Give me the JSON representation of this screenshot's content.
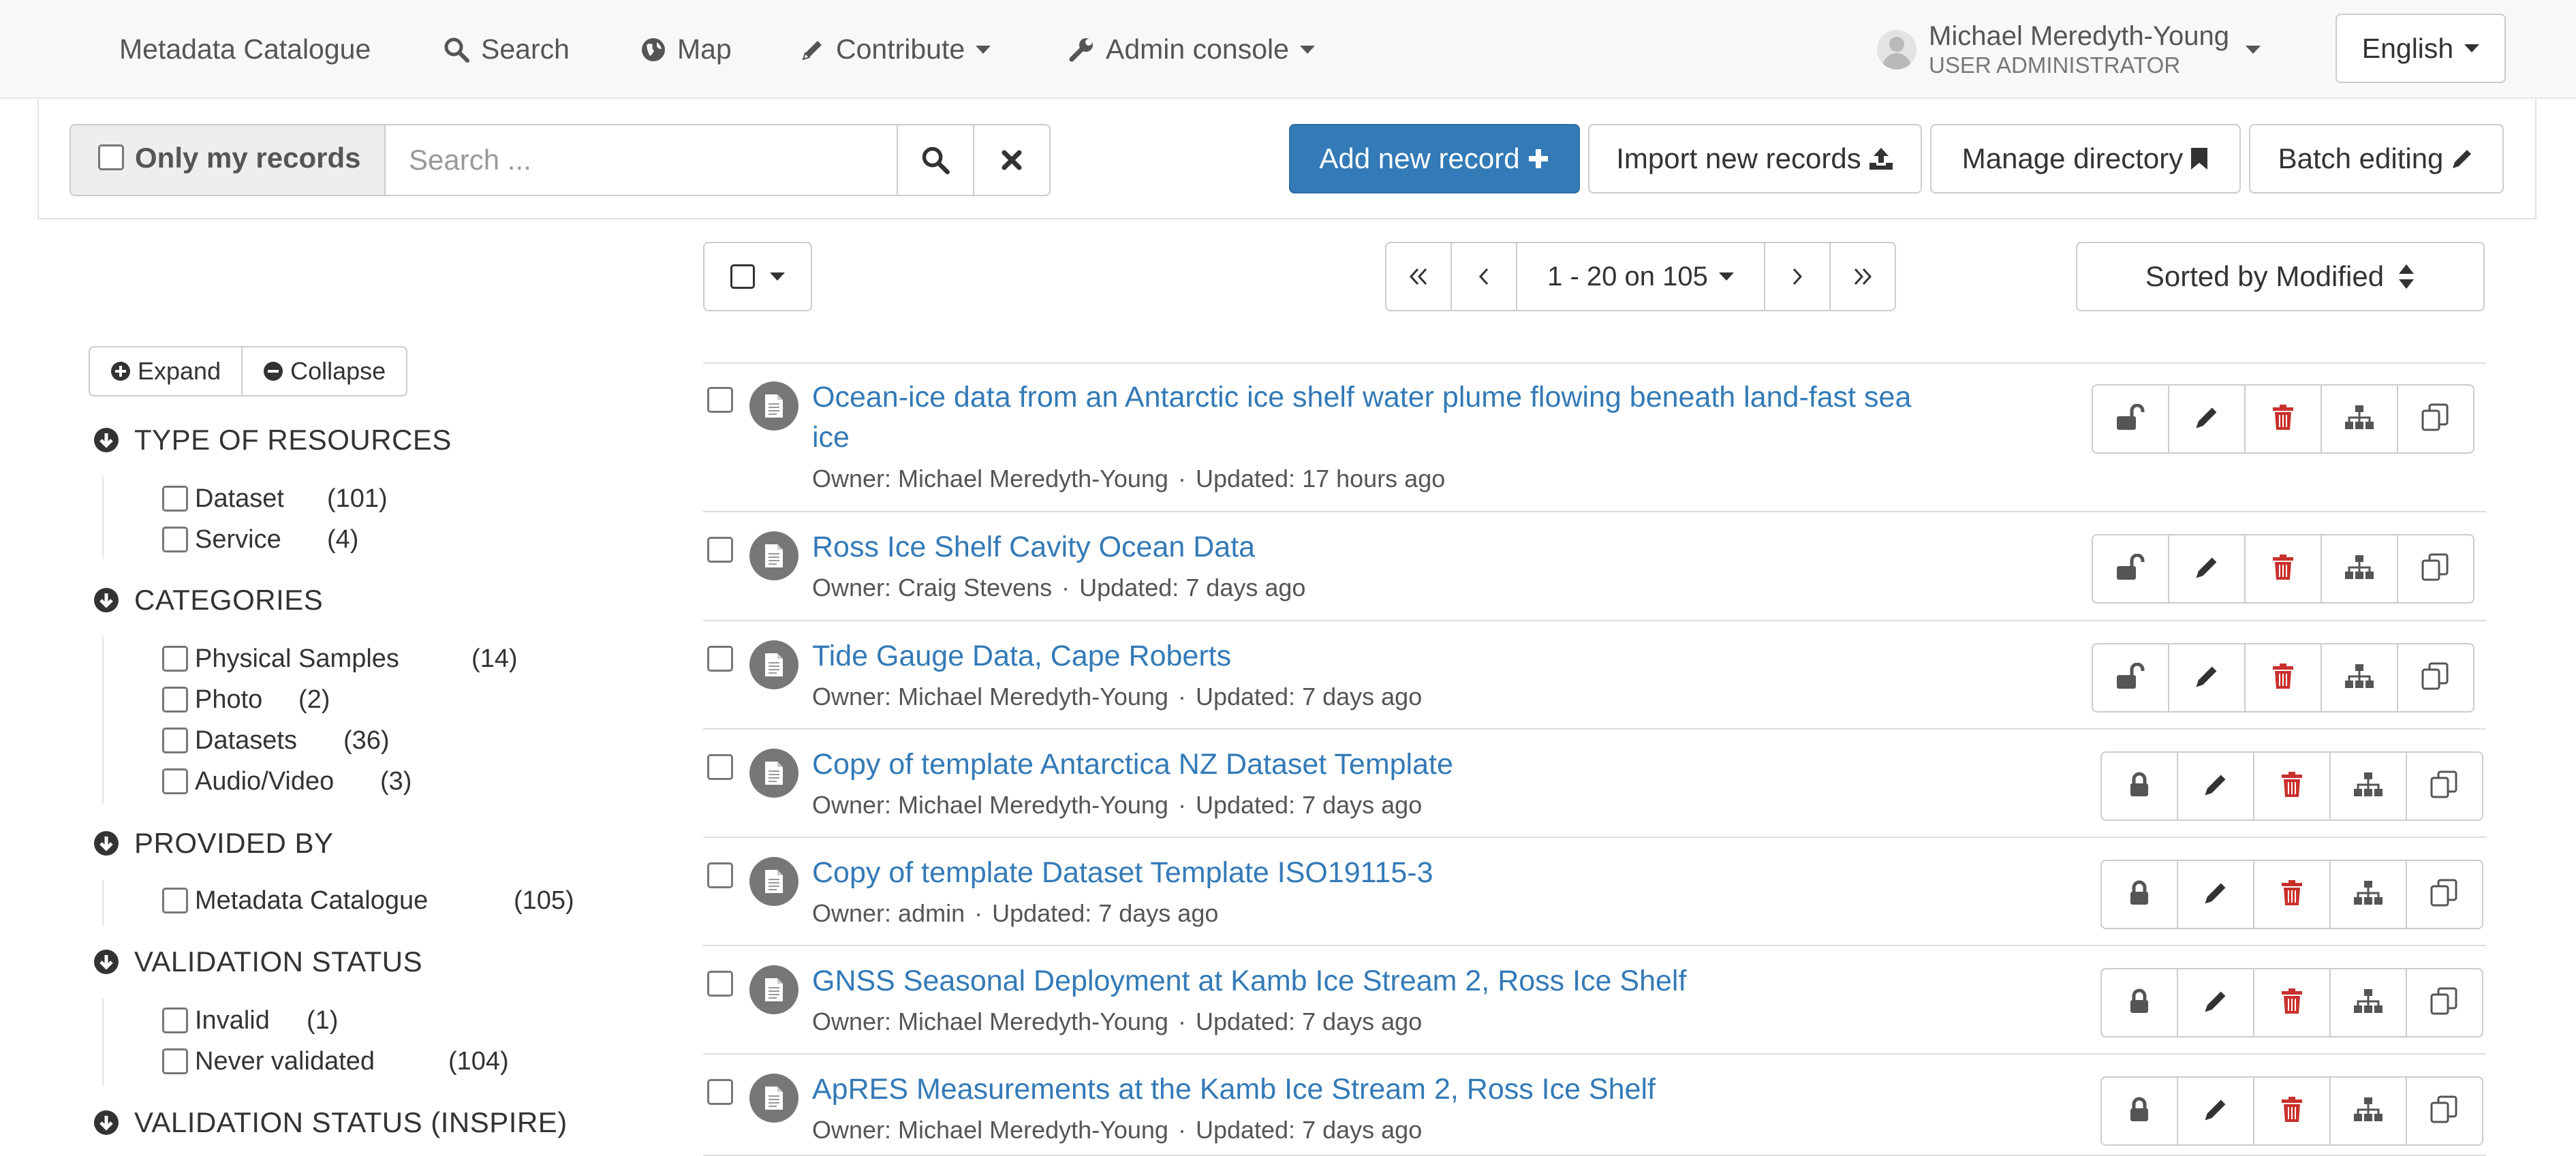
{
  "navbar": {
    "brand": "Metadata Catalogue",
    "search": "Search",
    "map": "Map",
    "contribute": "Contribute",
    "admin": "Admin console",
    "user_name": "Michael Meredyth-Young",
    "user_role": "USER ADMINISTRATOR",
    "language": "English"
  },
  "searchbar": {
    "only_my_records": "Only my records",
    "placeholder": "Search ...",
    "add_new_record": "Add new record",
    "import_new_records": "Import new records",
    "manage_directory": "Manage directory",
    "batch_editing": "Batch editing"
  },
  "sidebar": {
    "expand": "Expand",
    "collapse": "Collapse",
    "facets": [
      {
        "title": "TYPE OF RESOURCES",
        "items": [
          {
            "label": "Dataset",
            "count": "(101)"
          },
          {
            "label": "Service",
            "count": "(4)"
          }
        ]
      },
      {
        "title": "CATEGORIES",
        "items": [
          {
            "label": "Physical Samples",
            "count": "(14)"
          },
          {
            "label": "Photo",
            "count": "(2)"
          },
          {
            "label": "Datasets",
            "count": "(36)"
          },
          {
            "label": "Audio/Video",
            "count": "(3)"
          }
        ]
      },
      {
        "title": "PROVIDED BY",
        "items": [
          {
            "label": "Metadata Catalogue",
            "count": "(105)"
          }
        ]
      },
      {
        "title": "VALIDATION STATUS",
        "items": [
          {
            "label": "Invalid",
            "count": "(1)"
          },
          {
            "label": "Never validated",
            "count": "(104)"
          }
        ]
      },
      {
        "title": "VALIDATION STATUS (INSPIRE)",
        "items": []
      }
    ]
  },
  "results": {
    "pager_label": "1 - 20 on 105",
    "sort_label": "Sorted by Modified",
    "owner_prefix": "Owner: ",
    "updated_prefix": "Updated: ",
    "separator": "·",
    "records": [
      {
        "title": "Ocean-ice data from an Antarctic ice shelf water plume flowing beneath land-fast sea ice",
        "owner": "Michael Meredyth-Young",
        "updated": "17 hours ago",
        "locked": false
      },
      {
        "title": "Ross Ice Shelf Cavity Ocean Data",
        "owner": "Craig Stevens",
        "updated": "7 days ago",
        "locked": false
      },
      {
        "title": "Tide Gauge Data, Cape Roberts",
        "owner": "Michael Meredyth-Young",
        "updated": "7 days ago",
        "locked": false
      },
      {
        "title": "Copy of template Antarctica NZ Dataset Template",
        "owner": "Michael Meredyth-Young",
        "updated": "7 days ago",
        "locked": true
      },
      {
        "title": "Copy of template Dataset Template ISO19115-3",
        "owner": "admin",
        "updated": "7 days ago",
        "locked": true
      },
      {
        "title": "GNSS Seasonal Deployment at Kamb Ice Stream 2, Ross Ice Shelf",
        "owner": "Michael Meredyth-Young",
        "updated": "7 days ago",
        "locked": true
      },
      {
        "title": "ApRES Measurements at the Kamb Ice Stream 2, Ross Ice Shelf",
        "owner": "Michael Meredyth-Young",
        "updated": "7 days ago",
        "locked": true
      }
    ]
  },
  "colors": {
    "primary": "#337ab7",
    "danger": "#c9302c",
    "link": "#337ab7"
  }
}
